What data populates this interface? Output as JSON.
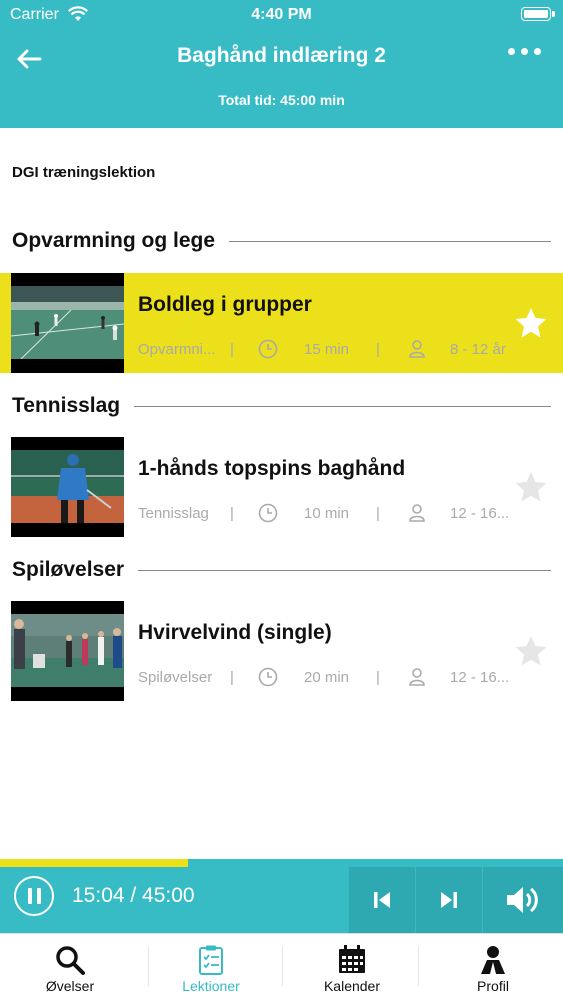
{
  "status_bar": {
    "carrier": "Carrier",
    "time": "4:40 PM"
  },
  "header": {
    "title": "Baghånd indlæring 2",
    "subtitle": "Total tid: 45:00 min"
  },
  "lesson": {
    "type": "DGI træningslektion"
  },
  "sections": [
    {
      "title": "Opvarmning og lege",
      "exercises": [
        {
          "title": "Boldleg i grupper",
          "category": "Opvarmni...",
          "duration": "15 min",
          "age": "8 - 12 år",
          "highlighted": true
        }
      ]
    },
    {
      "title": "Tennisslag",
      "exercises": [
        {
          "title": "1-hånds topspins baghånd",
          "category": "Tennisslag",
          "duration": "10 min",
          "age": "12 - 16...",
          "highlighted": false
        }
      ]
    },
    {
      "title": "Spiløvelser",
      "exercises": [
        {
          "title": "Hvirvelvind (single)",
          "category": "Spiløvelser",
          "duration": "20 min",
          "age": "12 - 16...",
          "highlighted": false
        }
      ]
    }
  ],
  "meta_separator": "|",
  "player": {
    "time": "15:04 / 45:00",
    "progress": 0.334
  },
  "tabs": [
    {
      "label": "Øvelser",
      "icon": "search-icon",
      "active": false
    },
    {
      "label": "Lektioner",
      "icon": "clipboard-checklist-icon",
      "active": true
    },
    {
      "label": "Kalender",
      "icon": "calendar-icon",
      "active": false
    },
    {
      "label": "Profil",
      "icon": "profile-icon",
      "active": false
    }
  ],
  "colors": {
    "accent": "#37bcc6",
    "accent_dark": "#2ea8b1",
    "highlight": "#ece01a",
    "star_active": "#ffffff",
    "star_inactive": "#e6e6e6"
  }
}
